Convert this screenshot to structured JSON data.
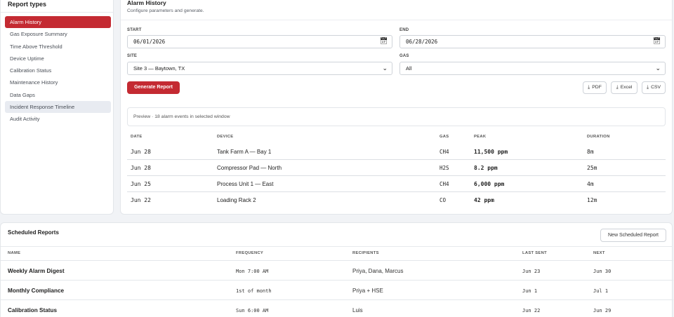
{
  "sidebar": {
    "title": "Report types",
    "items": [
      {
        "label": "Alarm History"
      },
      {
        "label": "Gas Exposure Summary"
      },
      {
        "label": "Time Above Threshold"
      },
      {
        "label": "Device Uptime"
      },
      {
        "label": "Calibration Status"
      },
      {
        "label": "Maintenance History"
      },
      {
        "label": "Data Gaps"
      },
      {
        "label": "Incident Response Timeline"
      },
      {
        "label": "Audit Activity"
      }
    ]
  },
  "main": {
    "title": "Alarm History",
    "subtitle": "Configure parameters and generate.",
    "start": {
      "label": "START",
      "value": "06/01/2026"
    },
    "end": {
      "label": "END",
      "value": "06/28/2026"
    },
    "site": {
      "label": "SITE",
      "value": "Site 3 — Baytown, TX"
    },
    "gas": {
      "label": "GAS",
      "value": "All"
    },
    "generate_label": "Generate Report",
    "export": {
      "pdf": "PDF",
      "excel": "Excel",
      "csv": "CSV"
    },
    "preview_text": "Preview · 18 alarm events in selected window",
    "table": {
      "headers": {
        "date": "DATE",
        "device": "DEVICE",
        "gas": "GAS",
        "peak": "PEAK",
        "duration": "DURATION"
      },
      "rows": [
        {
          "date": "Jun 28",
          "device": "Tank Farm A — Bay 1",
          "gas": "CH4",
          "peak": "11,500 ppm",
          "duration": "8m"
        },
        {
          "date": "Jun 28",
          "device": "Compressor Pad — North",
          "gas": "H2S",
          "peak": "8.2 ppm",
          "duration": "25m"
        },
        {
          "date": "Jun 25",
          "device": "Process Unit 1 — East",
          "gas": "CH4",
          "peak": "6,000 ppm",
          "duration": "4m"
        },
        {
          "date": "Jun 22",
          "device": "Loading Rack 2",
          "gas": "CO",
          "peak": "42 ppm",
          "duration": "12m"
        }
      ]
    }
  },
  "scheduled": {
    "title": "Scheduled Reports",
    "new_label": "New Scheduled Report",
    "headers": {
      "name": "NAME",
      "frequency": "FREQUENCY",
      "recipients": "RECIPIENTS",
      "last_sent": "LAST SENT",
      "next": "NEXT"
    },
    "rows": [
      {
        "name": "Weekly Alarm Digest",
        "frequency": "Mon 7:00 AM",
        "recipients": "Priya, Dana, Marcus",
        "last_sent": "Jun 23",
        "next": "Jun 30"
      },
      {
        "name": "Monthly Compliance",
        "frequency": "1st of month",
        "recipients": "Priya + HSE",
        "last_sent": "Jun 1",
        "next": "Jul 1"
      },
      {
        "name": "Calibration Status",
        "frequency": "Sun 6:00 AM",
        "recipients": "Luis",
        "last_sent": "Jun 22",
        "next": "Jun 29"
      }
    ]
  },
  "colors": {
    "accent": "#c42a32",
    "hover": "#e8ebf1"
  },
  "icons": {
    "calendar": "calendar-icon",
    "chevron": "chevron-down-icon",
    "download": "download-icon"
  }
}
